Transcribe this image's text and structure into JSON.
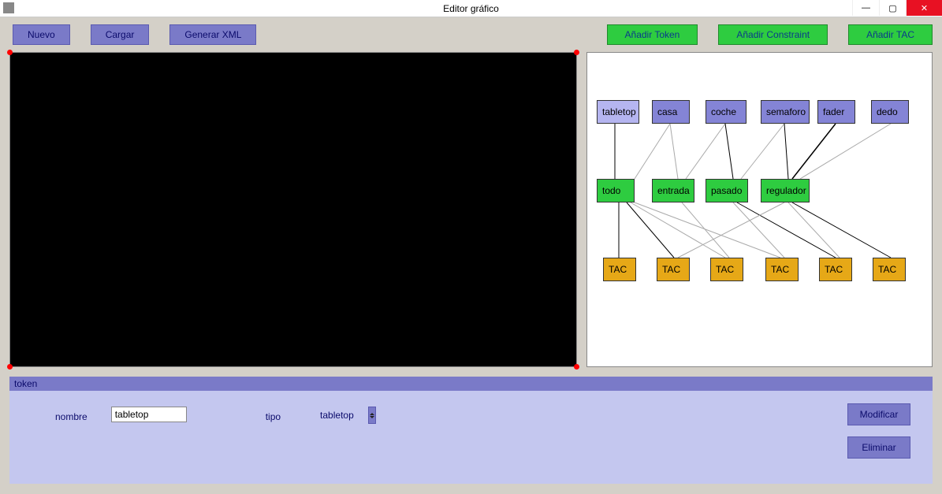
{
  "title": "Editor gráfico",
  "toolbar": {
    "nuevo": "Nuevo",
    "cargar": "Cargar",
    "generar": "Generar XML",
    "add_token": "Añadir Token",
    "add_constraint": "Añadir Constraint",
    "add_tac": "Añadir TAC"
  },
  "graph": {
    "tokens": [
      "tabletop",
      "casa",
      "coche",
      "semaforo",
      "fader",
      "dedo"
    ],
    "constraints": [
      "todo",
      "entrada",
      "pasado",
      "regulador"
    ],
    "tacs": [
      "TAC",
      "TAC",
      "TAC",
      "TAC",
      "TAC",
      "TAC"
    ]
  },
  "panel": {
    "header": "token",
    "nombre_label": "nombre",
    "nombre_value": "tabletop",
    "tipo_label": "tipo",
    "tipo_value": "tabletop",
    "modificar": "Modificar",
    "eliminar": "Eliminar"
  }
}
